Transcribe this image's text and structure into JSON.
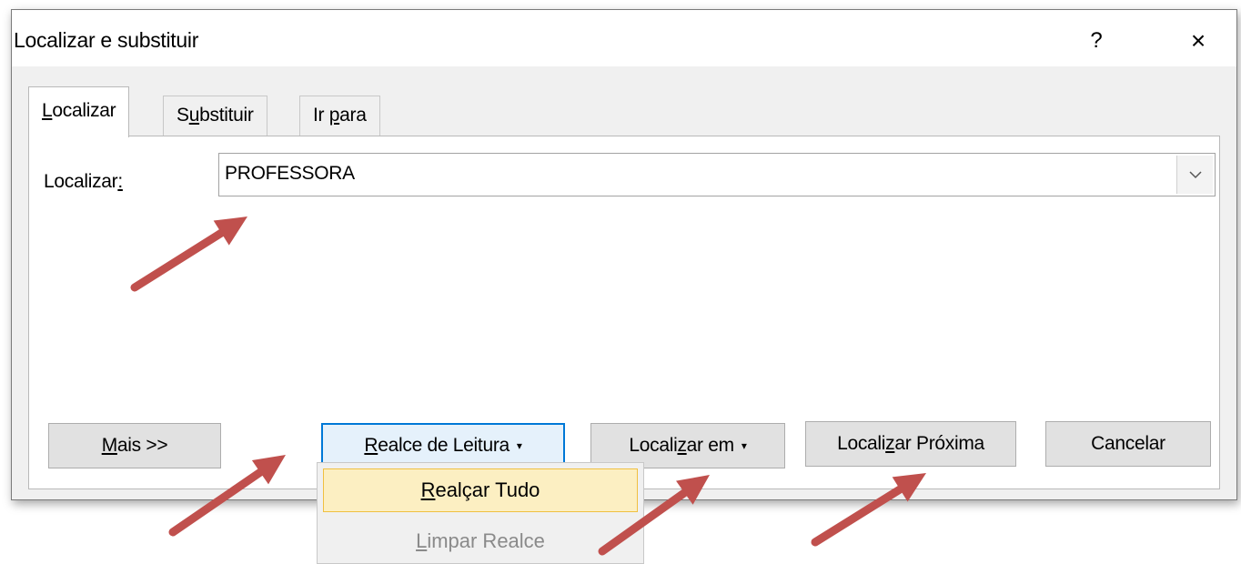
{
  "dialog": {
    "title": "Localizar e substituir",
    "help_label": "?",
    "close_label": "×"
  },
  "tabs": [
    {
      "label_pre": "",
      "label_ul": "L",
      "label_post": "ocalizar"
    },
    {
      "label_pre": "S",
      "label_ul": "u",
      "label_post": "bstituir"
    },
    {
      "label_pre": "Ir ",
      "label_ul": "p",
      "label_post": "ara"
    }
  ],
  "find": {
    "label_pre": "Localizar",
    "label_ul": ":",
    "value": "PROFESSORA",
    "dropdown_icon": "chevron-down-icon"
  },
  "buttons": {
    "more": {
      "ul": "M",
      "rest": "ais >>"
    },
    "reading_highlight": {
      "ul": "R",
      "rest": "ealce de Leitura",
      "caret": "▾"
    },
    "find_in": {
      "pre": "Locali",
      "ul": "z",
      "rest": "ar em",
      "caret": "▾"
    },
    "find_next": {
      "pre": "Locali",
      "ul": "z",
      "rest": "ar Próxima"
    },
    "cancel": "Cancelar"
  },
  "highlight_menu": {
    "highlight_all": {
      "ul": "R",
      "rest": "ealçar Tudo"
    },
    "clear_highlight": {
      "ul": "L",
      "rest": "impar Realce"
    }
  },
  "annotations": {
    "arrow_color": "#c0504d"
  }
}
